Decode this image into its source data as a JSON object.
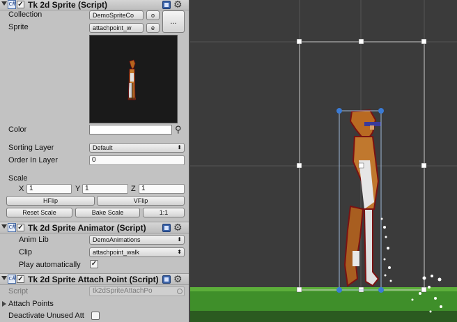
{
  "sprite_component": {
    "title": "Tk 2d Sprite (Script)",
    "collection_label": "Collection",
    "collection_value": "DemoSpriteCo",
    "collection_btn": "o",
    "sprite_label": "Sprite",
    "sprite_value": "attachpoint_w",
    "sprite_btn": "e",
    "more_btn": "...",
    "color_label": "Color",
    "sorting_layer_label": "Sorting Layer",
    "sorting_layer_value": "Default",
    "order_label": "Order In Layer",
    "order_value": "0",
    "scale_label": "Scale",
    "scale_x_label": "X",
    "scale_x": "1",
    "scale_y_label": "Y",
    "scale_y": "1",
    "scale_z_label": "Z",
    "scale_z": "1",
    "hflip": "HFlip",
    "vflip": "VFlip",
    "reset_scale": "Reset Scale",
    "bake_scale": "Bake Scale",
    "one_to_one": "1:1",
    "color_value": "#ffffff"
  },
  "animator_component": {
    "title": "Tk 2d Sprite Animator (Script)",
    "anim_lib_label": "Anim Lib",
    "anim_lib_value": "DemoAnimations",
    "clip_label": "Clip",
    "clip_value": "attachpoint_walk",
    "play_auto_label": "Play automatically",
    "play_auto_checked": true
  },
  "attach_component": {
    "title": "Tk 2d Sprite Attach Point (Script)",
    "script_label": "Script",
    "script_value": "tk2dSpriteAttachPo",
    "attach_points_label": "Attach Points",
    "deactivate_label": "Deactivate Unused Att"
  },
  "icons": {
    "component_icon": "script-hash-icon",
    "help_icon": "book-help-icon",
    "settings_icon": "gear-icon",
    "color_picker_icon": "eyedropper-icon",
    "dropdown_icon": "chevron-down-icon"
  },
  "colors": {
    "inspector_bg": "#c2c2c2",
    "scene_bg": "#3b3b3b",
    "ground_green": "#3f8f2a",
    "selection_blue": "#3a7bd5"
  }
}
